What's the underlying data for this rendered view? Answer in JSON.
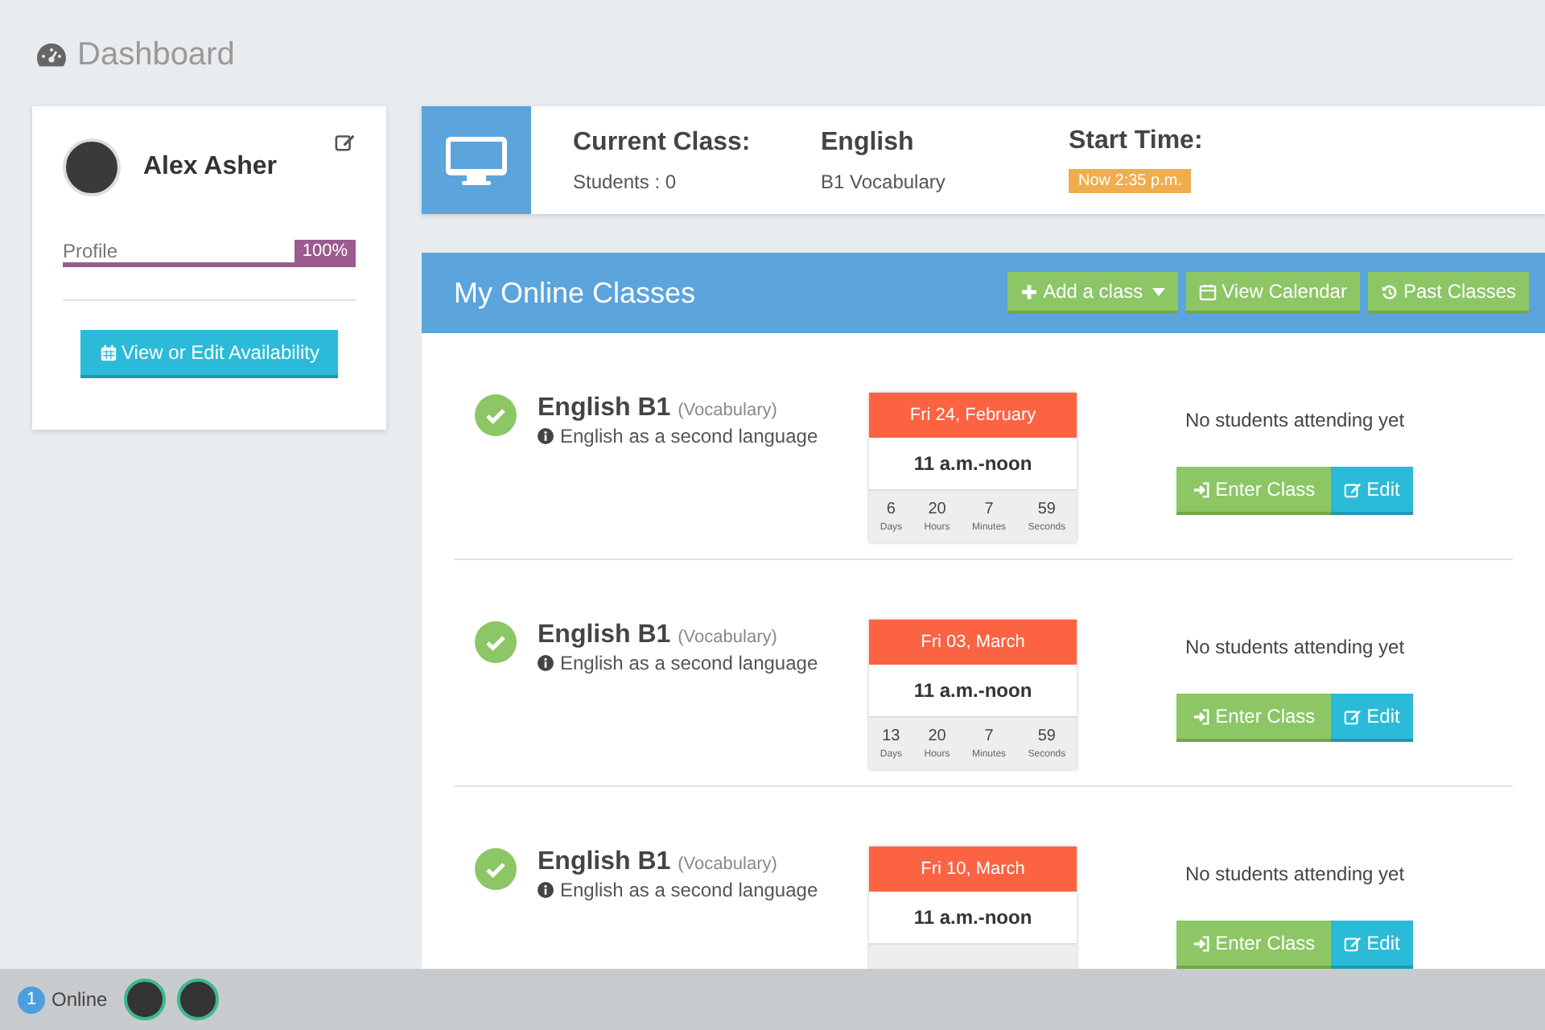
{
  "page_title": "Dashboard",
  "profile": {
    "name": "Alex Asher",
    "progress_label": "Profile",
    "progress_value": "100%",
    "level": 1.0,
    "button": "View or Edit Availability"
  },
  "current_class": {
    "title": "Current Class:",
    "students": "Students : 0",
    "subject": "English",
    "subject_detail": "B1 Vocabulary",
    "start_label": "Start Time:",
    "start_badge": "Now 2:35 p.m."
  },
  "classes_panel": {
    "title": "My Online Classes",
    "buttons": [
      {
        "kind": "add",
        "label": "Add a class"
      },
      {
        "kind": "calendar",
        "label": "View Calendar"
      },
      {
        "kind": "history",
        "label": "Past Classes"
      }
    ]
  },
  "classes": [
    {
      "title": "English B1",
      "tag": "(Vocabulary)",
      "description": "English as a second language",
      "date": "Fri 24, February",
      "time": "11 a.m.-noon",
      "countdown": [
        {
          "value": "6",
          "unit": "Days"
        },
        {
          "value": "20",
          "unit": "Hours"
        },
        {
          "value": "7",
          "unit": "Minutes"
        },
        {
          "value": "59",
          "unit": "Seconds"
        }
      ],
      "attendance": "No students attending yet",
      "enter": "Enter Class",
      "edit": "Edit"
    },
    {
      "title": "English B1",
      "tag": "(Vocabulary)",
      "description": "English as a second language",
      "date": "Fri 03, March",
      "time": "11 a.m.-noon",
      "countdown": [
        {
          "value": "13",
          "unit": "Days"
        },
        {
          "value": "20",
          "unit": "Hours"
        },
        {
          "value": "7",
          "unit": "Minutes"
        },
        {
          "value": "59",
          "unit": "Seconds"
        }
      ],
      "attendance": "No students attending yet",
      "enter": "Enter Class",
      "edit": "Edit"
    },
    {
      "title": "English B1",
      "tag": "(Vocabulary)",
      "description": "English as a second language",
      "date": "Fri 10, March",
      "time": "11 a.m.-noon",
      "attendance": "No students attending yet",
      "enter": "Enter Class",
      "edit": "Edit"
    }
  ],
  "online_bar": {
    "count": "1",
    "label": "Online",
    "users": [
      {
        "kind": "user"
      },
      {
        "kind": "user"
      }
    ]
  }
}
